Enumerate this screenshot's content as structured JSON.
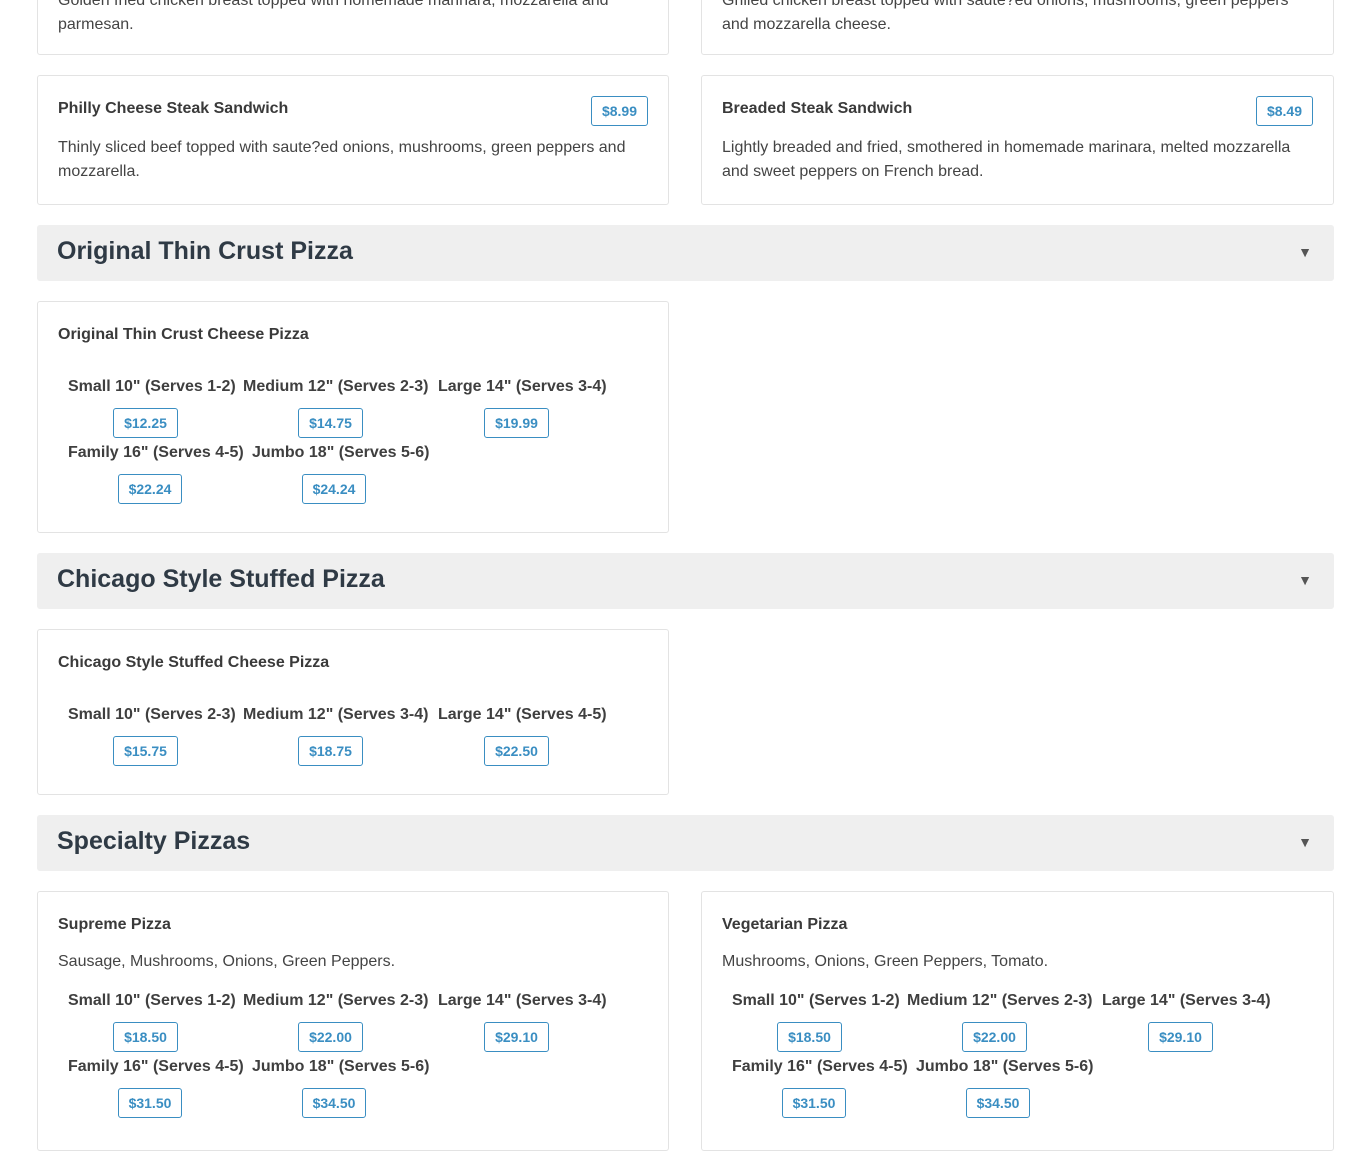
{
  "top_cards": [
    {
      "desc": "Golden fried chicken breast topped with homemade marinara, mozzarella and parmesan."
    },
    {
      "desc": "Grilled chicken breast topped with saute?ed onions, mushrooms, green peppers and mozzarella cheese."
    }
  ],
  "sandwiches": [
    {
      "name": "Philly Cheese Steak Sandwich",
      "price": "$8.99",
      "desc": "Thinly sliced beef topped with saute?ed onions, mushrooms, green peppers and mozzarella."
    },
    {
      "name": "Breaded Steak Sandwich",
      "price": "$8.49",
      "desc": "Lightly breaded and fried, smothered in homemade marinara, melted mozzarella and sweet peppers on French bread."
    }
  ],
  "sections": {
    "thin": {
      "title": "Original Thin Crust Pizza",
      "caret": "▼"
    },
    "chicago": {
      "title": "Chicago Style Stuffed Pizza",
      "caret": "▼"
    },
    "specialty": {
      "title": "Specialty Pizzas",
      "caret": "▼"
    }
  },
  "thin_crust": {
    "name": "Original Thin Crust Cheese Pizza",
    "sizes": [
      {
        "label": "Small 10\" (Serves 1-2)",
        "price": "$12.25"
      },
      {
        "label": "Medium 12\" (Serves 2-3)",
        "price": "$14.75"
      },
      {
        "label": "Large 14\" (Serves 3-4)",
        "price": "$19.99"
      },
      {
        "label": "Family 16\" (Serves 4-5)",
        "price": "$22.24"
      },
      {
        "label": "Jumbo 18\" (Serves 5-6)",
        "price": "$24.24"
      }
    ]
  },
  "chicago_style": {
    "name": "Chicago Style Stuffed Cheese Pizza",
    "sizes": [
      {
        "label": "Small 10\" (Serves 2-3)",
        "price": "$15.75"
      },
      {
        "label": "Medium 12\" (Serves 3-4)",
        "price": "$18.75"
      },
      {
        "label": "Large 14\" (Serves 4-5)",
        "price": "$22.50"
      }
    ]
  },
  "supreme": {
    "name": "Supreme Pizza",
    "desc": "Sausage, Mushrooms, Onions, Green Peppers.",
    "sizes": [
      {
        "label": "Small 10\" (Serves 1-2)",
        "price": "$18.50"
      },
      {
        "label": "Medium 12\" (Serves 2-3)",
        "price": "$22.00"
      },
      {
        "label": "Large 14\" (Serves 3-4)",
        "price": "$29.10"
      },
      {
        "label": "Family 16\" (Serves 4-5)",
        "price": "$31.50"
      },
      {
        "label": "Jumbo 18\" (Serves 5-6)",
        "price": "$34.50"
      }
    ]
  },
  "vegetarian": {
    "name": "Vegetarian Pizza",
    "desc": "Mushrooms, Onions, Green Peppers, Tomato.",
    "sizes": [
      {
        "label": "Small 10\" (Serves 1-2)",
        "price": "$18.50"
      },
      {
        "label": "Medium 12\" (Serves 2-3)",
        "price": "$22.00"
      },
      {
        "label": "Large 14\" (Serves 3-4)",
        "price": "$29.10"
      },
      {
        "label": "Family 16\" (Serves 4-5)",
        "price": "$31.50"
      },
      {
        "label": "Jumbo 18\" (Serves 5-6)",
        "price": "$34.50"
      }
    ]
  }
}
